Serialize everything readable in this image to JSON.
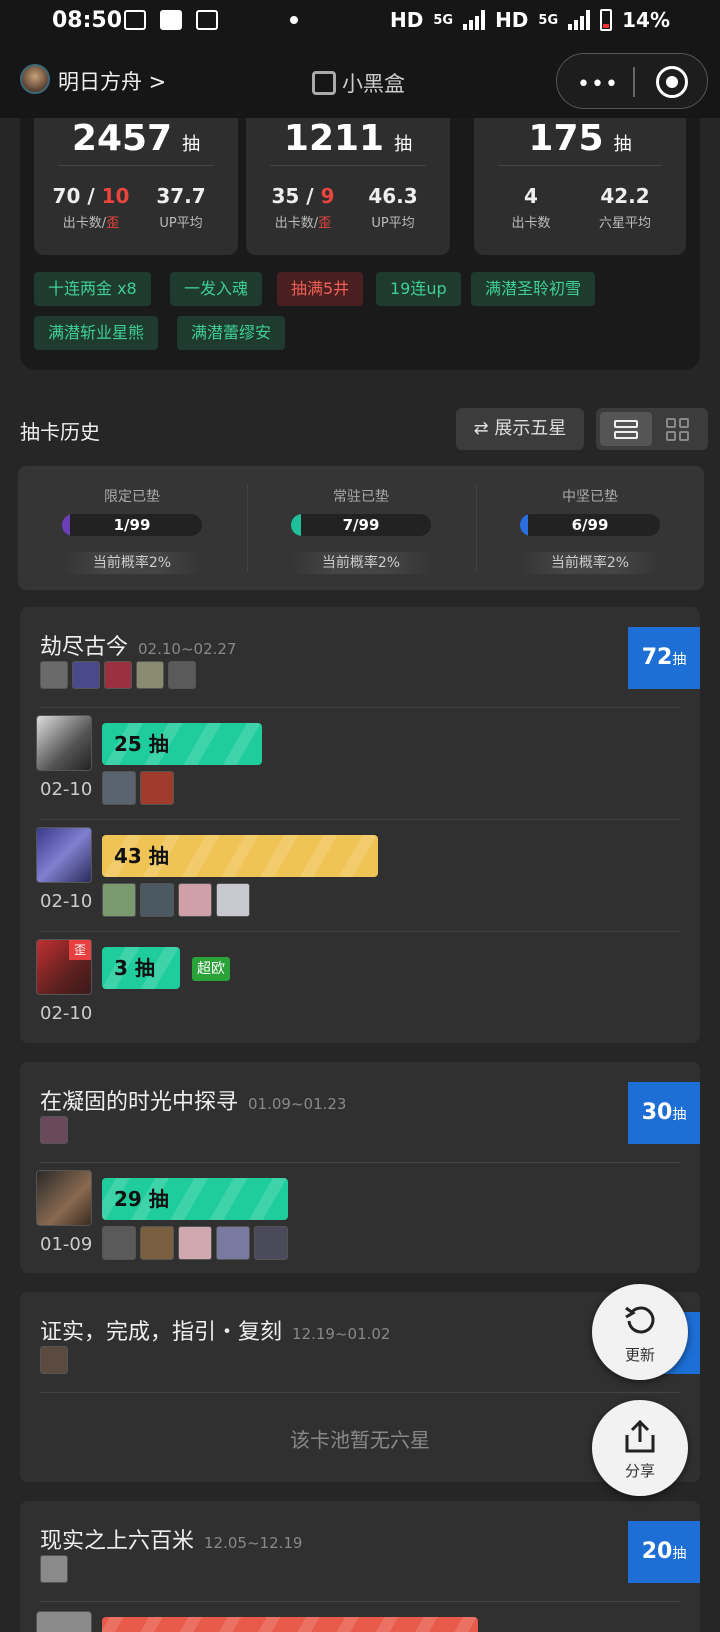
{
  "status_bar": {
    "time": "08:50",
    "network_1": "HD",
    "net_type_1": "5G",
    "network_2": "HD",
    "net_type_2": "5G",
    "battery": "14%"
  },
  "header": {
    "app_name": "明日方舟 >",
    "brand": "小黑盒",
    "more": "•••"
  },
  "summary": {
    "cards": [
      {
        "total": "2457",
        "unit": "抽",
        "count": "70",
        "wai": "10",
        "count_label": "出卡数",
        "wai_label": "歪",
        "avg": "37.7",
        "avg_label": "UP平均"
      },
      {
        "total": "1211",
        "unit": "抽",
        "count": "35",
        "wai": "9",
        "count_label": "出卡数",
        "wai_label": "歪",
        "avg": "46.3",
        "avg_label": "UP平均"
      },
      {
        "total": "175",
        "unit": "抽",
        "count": "4",
        "count_label": "出卡数",
        "avg": "42.2",
        "avg_label": "六星平均"
      }
    ],
    "tags": [
      "十连两金 x8",
      "一发入魂",
      "抽满5井",
      "19连up",
      "满潜圣聆初雪",
      "满潜斩业星熊",
      "满潜蕾缪安"
    ]
  },
  "history": {
    "title": "抽卡历史",
    "show_five_star": "⇄ 展示五星"
  },
  "pity": [
    {
      "label": "限定已垫",
      "value": "1/99",
      "progress": 0.0101,
      "color": "#6a3fb8",
      "rate": "当前概率2%"
    },
    {
      "label": "常驻已垫",
      "value": "7/99",
      "progress": 0.0707,
      "color": "#1fbf9a",
      "rate": "当前概率2%"
    },
    {
      "label": "中坚已垫",
      "value": "6/99",
      "progress": 0.0606,
      "color": "#2a6ee0",
      "rate": "当前概率2%"
    }
  ],
  "pools": [
    {
      "name": "劫尽古今",
      "date": "02.10~02.27",
      "total": "72",
      "unit": "抽",
      "pulls": [
        {
          "count": "25 抽",
          "date": "02-10",
          "color": "green",
          "progress": 0.25
        },
        {
          "count": "43 抽",
          "date": "02-10",
          "color": "yellow",
          "progress": 0.43
        },
        {
          "count": "3 抽",
          "date": "02-10",
          "color": "green",
          "progress": 0.03,
          "badge": "超欧",
          "wai": "歪"
        }
      ]
    },
    {
      "name": "在凝固的时光中探寻",
      "date": "01.09~01.23",
      "total": "30",
      "unit": "抽",
      "pulls": [
        {
          "count": "29 抽",
          "date": "01-09",
          "color": "green",
          "progress": 0.29
        }
      ]
    },
    {
      "name": "证实，完成，指引・复刻",
      "date": "12.19~01.02",
      "total": "",
      "unit": "抽",
      "empty": "该卡池暂无六星"
    },
    {
      "name": "现实之上六百米",
      "date": "12.05~12.19",
      "total": "20",
      "unit": "抽"
    }
  ],
  "fabs": {
    "refresh": "更新",
    "share": "分享"
  }
}
